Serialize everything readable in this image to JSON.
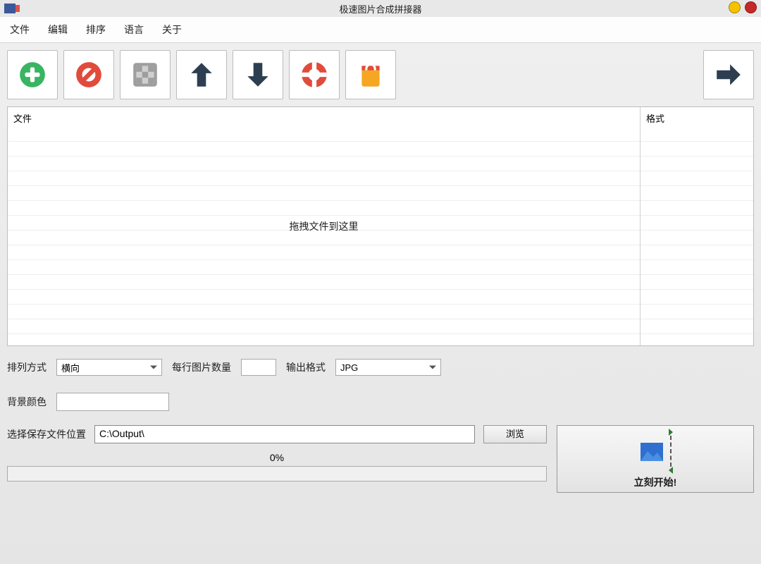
{
  "window": {
    "title": "极速图片合成拼接器"
  },
  "menu": {
    "file": "文件",
    "edit": "编辑",
    "sort": "排序",
    "language": "语言",
    "about": "关于"
  },
  "toolbar_icons": {
    "add": "add-icon",
    "remove": "remove-icon",
    "clear": "clear-icon",
    "up": "arrow-up-icon",
    "down": "arrow-down-icon",
    "help": "lifebuoy-icon",
    "shop": "shopping-bag-icon",
    "next": "arrow-right-icon"
  },
  "columns": {
    "file": "文件",
    "format": "格式"
  },
  "drop_hint": "拖拽文件到这里",
  "options": {
    "arrange_label": "排列方式",
    "arrange_value": "横向",
    "per_row_label": "每行图片数量",
    "per_row_value": "",
    "output_label": "输出格式",
    "output_value": "JPG",
    "bgcolor_label": "背景颜色"
  },
  "save": {
    "label": "选择保存文件位置",
    "path": "C:\\Output\\",
    "browse": "浏览"
  },
  "progress": {
    "text": "0%"
  },
  "start": {
    "label": "立刻开始!"
  }
}
